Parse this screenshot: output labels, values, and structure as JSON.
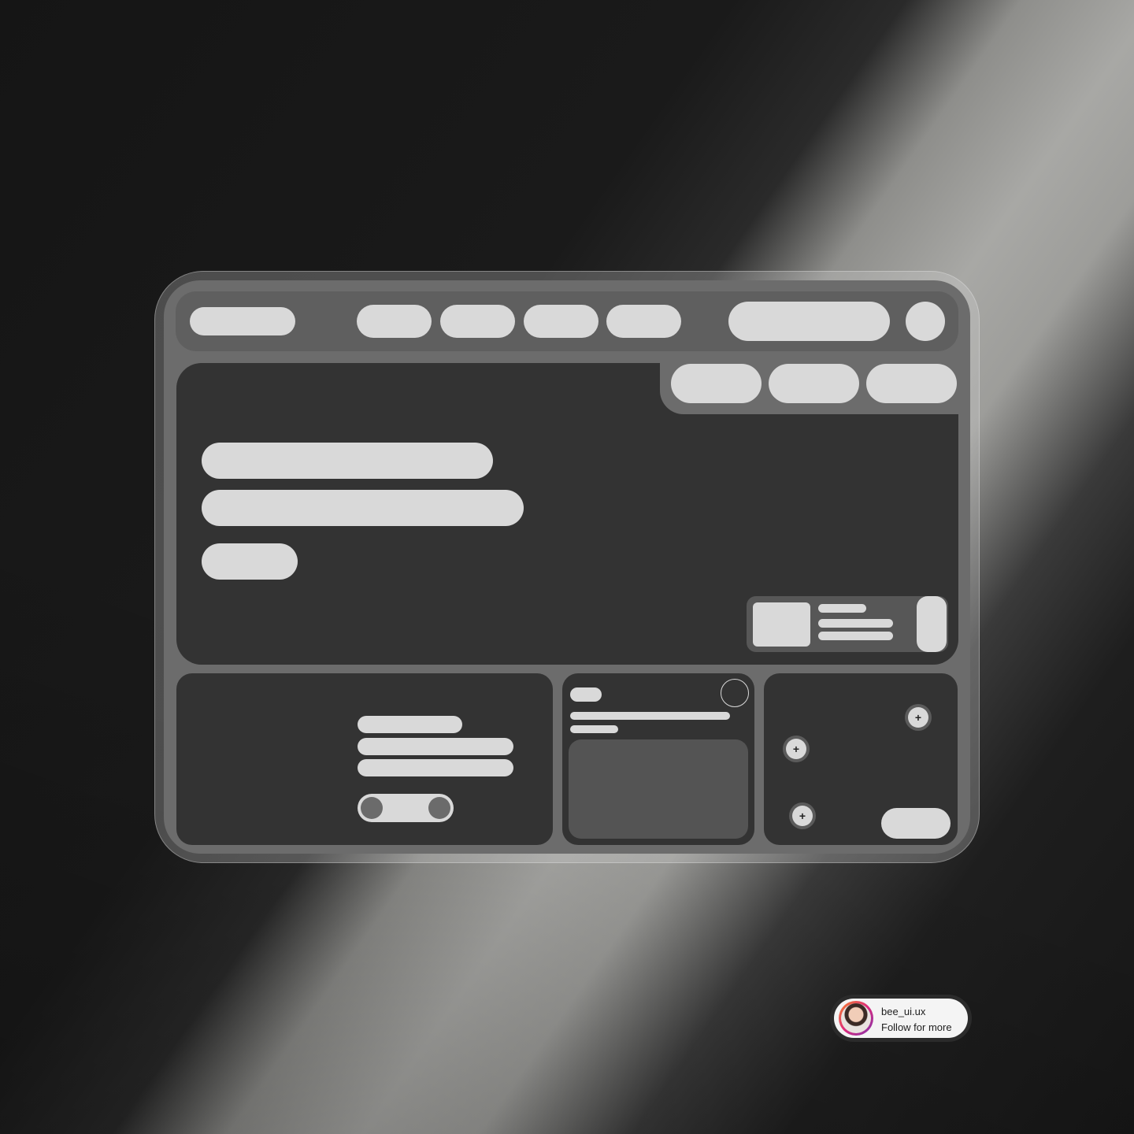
{
  "colors": {
    "background_dark": "#1c1c1c",
    "frame_gray": "#6c6c6c",
    "panel_dark": "#333333",
    "placeholder": "#d9d9d9"
  },
  "badge": {
    "username": "bee_ui.ux",
    "subtitle": "Follow for more",
    "avatar_icon": "profile-photo"
  },
  "icons": {
    "plus": "+"
  }
}
